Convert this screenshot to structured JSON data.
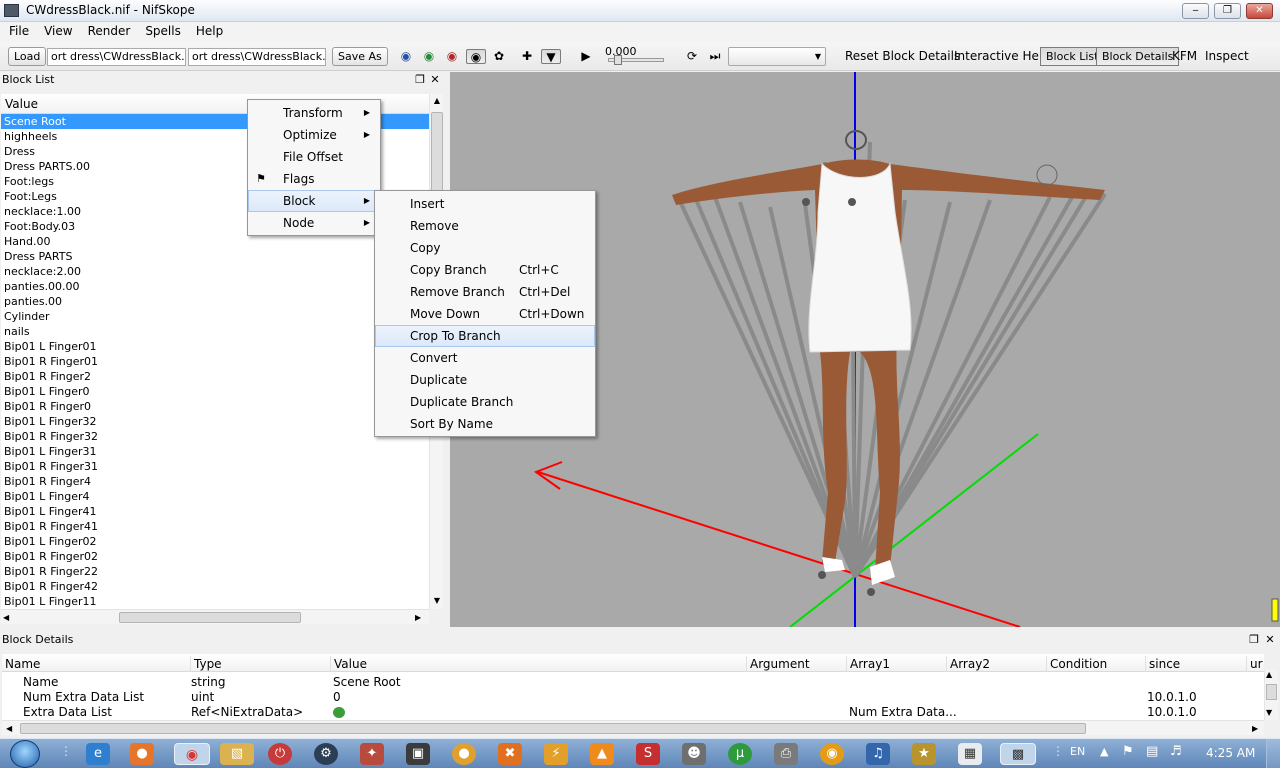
{
  "window": {
    "title": "CWdressBlack.nif - NifSkope",
    "minimize": "‒",
    "restore": "❐",
    "close": "✕"
  },
  "menu": [
    "File",
    "View",
    "Render",
    "Spells",
    "Help"
  ],
  "toolbar": {
    "load_label": "Load",
    "load_path": "ort dress\\CWdressBlack.nif",
    "save_path": "ort dress\\CWdressBlack.nif",
    "save_as_label": "Save As",
    "time_value": "0.000",
    "anim_select": "",
    "reset_label": "Reset Block Details",
    "help_label": "Interactive Help",
    "block_list_label": "Block List",
    "block_details_label": "Block Details",
    "kfm_label": "KFM",
    "inspect_label": "Inspect"
  },
  "block_list": {
    "title": "Block List",
    "column": "Value",
    "rows": [
      "Scene Root",
      "highheels",
      "Dress",
      "Dress PARTS.00",
      "Foot:legs",
      "Foot:Legs",
      "necklace:1.00",
      "Foot:Body.03",
      "Hand.00",
      "Dress PARTS",
      "necklace:2.00",
      "panties.00.00",
      "panties.00",
      "Cylinder",
      "nails",
      "Bip01 L Finger01",
      "Bip01 R Finger01",
      "Bip01 R Finger2",
      "Bip01 L Finger0",
      "Bip01 R Finger0",
      "Bip01 L Finger32",
      "Bip01 R Finger32",
      "Bip01 L Finger31",
      "Bip01 R Finger31",
      "Bip01 R Finger4",
      "Bip01 L Finger4",
      "Bip01 L Finger41",
      "Bip01 R Finger41",
      "Bip01 L Finger02",
      "Bip01 R Finger02",
      "Bip01 R Finger22",
      "Bip01 R Finger42",
      "Bip01 L Finger11"
    ],
    "selected_index": 0
  },
  "context_menu": {
    "items": [
      {
        "label": "Transform",
        "submenu": true
      },
      {
        "label": "Optimize",
        "submenu": true
      },
      {
        "label": "File Offset",
        "submenu": false
      },
      {
        "label": "Flags",
        "submenu": false
      },
      {
        "label": "Block",
        "submenu": true
      },
      {
        "label": "Node",
        "submenu": true
      }
    ]
  },
  "block_submenu": {
    "items": [
      {
        "label": "Insert",
        "shortcut": ""
      },
      {
        "label": "Remove",
        "shortcut": ""
      },
      {
        "label": "Copy",
        "shortcut": ""
      },
      {
        "label": "Copy Branch",
        "shortcut": "Ctrl+C"
      },
      {
        "label": "Remove Branch",
        "shortcut": "Ctrl+Del"
      },
      {
        "label": "Move Down",
        "shortcut": "Ctrl+Down"
      },
      {
        "label": "Crop To Branch",
        "shortcut": ""
      },
      {
        "label": "Convert",
        "shortcut": ""
      },
      {
        "label": "Duplicate",
        "shortcut": ""
      },
      {
        "label": "Duplicate Branch",
        "shortcut": ""
      },
      {
        "label": "Sort By Name",
        "shortcut": ""
      }
    ]
  },
  "details": {
    "title": "Block Details",
    "columns": [
      "Name",
      "Type",
      "Value",
      "Argument",
      "Array1",
      "Array2",
      "Condition",
      "since",
      "ur"
    ],
    "rows": [
      {
        "name": "Name",
        "type": "string",
        "value": "Scene Root",
        "argument": "",
        "array1": "",
        "array2": "",
        "condition": "",
        "since": ""
      },
      {
        "name": "Num Extra Data List",
        "type": "uint",
        "value": "0",
        "argument": "",
        "array1": "",
        "array2": "",
        "condition": "",
        "since": "10.0.1.0"
      },
      {
        "name": "Extra Data List",
        "type": "Ref<NiExtraData>",
        "value": "",
        "argument": "",
        "array1": "Num Extra Data...",
        "array2": "",
        "condition": "",
        "since": "10.0.1.0"
      }
    ]
  },
  "taskbar": {
    "icons": [
      "start-orb",
      "grip",
      "internet-explorer",
      "firefox",
      "chrome",
      "explorer",
      "power-app",
      "steam",
      "app-red",
      "winamp",
      "app-yellow",
      "media-app",
      "app-bolt",
      "vlc",
      "app-red-s",
      "app-cat",
      "utorrent",
      "app-printer",
      "app-orange",
      "headphones",
      "app-gold",
      "calculator",
      "nifskope"
    ],
    "lang": "EN",
    "clock": "4:25 AM"
  },
  "colors": {
    "selection": "#3399ff",
    "viewport_bg": "#a9a9a9",
    "axis_x": "#ff0000",
    "axis_y": "#00cc00",
    "axis_z": "#0000ff"
  }
}
